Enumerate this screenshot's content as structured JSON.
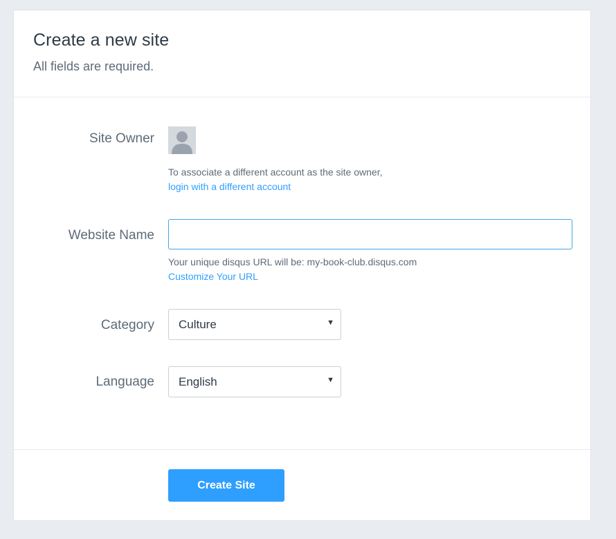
{
  "header": {
    "title": "Create a new site",
    "subtitle": "All fields are required."
  },
  "site_owner": {
    "label": "Site Owner",
    "avatar_icon": "user-avatar-icon",
    "help_text": "To associate a different account as the site owner,",
    "link_text": "login with a different account"
  },
  "website_name": {
    "label": "Website Name",
    "value": "",
    "placeholder": "",
    "url_hint": "Your unique disqus URL will be: my-book-club.disqus.com",
    "customize_link": "Customize Your URL"
  },
  "category": {
    "label": "Category",
    "selected": "Culture"
  },
  "language": {
    "label": "Language",
    "selected": "English"
  },
  "footer": {
    "create_button": "Create Site"
  },
  "colors": {
    "accent": "#2e9fff",
    "page_background": "#e9ecf1",
    "input_focus_border": "#47a3e6"
  }
}
